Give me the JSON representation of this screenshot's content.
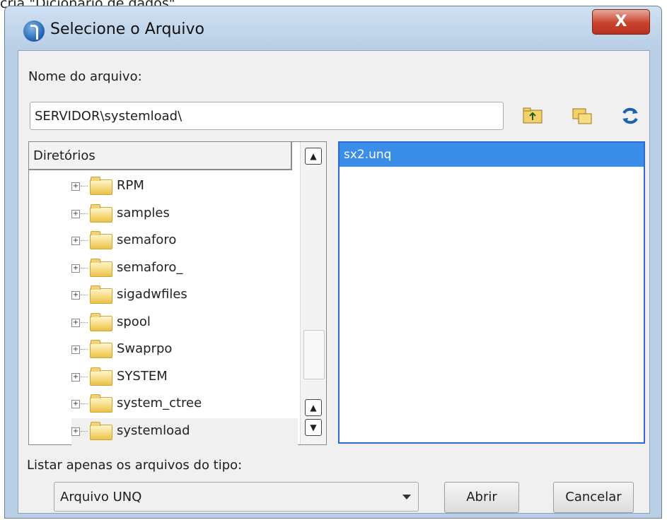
{
  "above_caption": "cria \"Dicionário de dados\"",
  "window": {
    "title": "Selecione o Arquivo",
    "close_label": "X"
  },
  "filename": {
    "label": "Nome do arquivo:",
    "value": "SERVIDOR\\systemload\\"
  },
  "toolbar": {
    "icons": [
      "folder-up-icon",
      "copy-folder-icon",
      "refresh-icon"
    ]
  },
  "directories": {
    "header": "Diretórios",
    "items": [
      {
        "name": "RPM"
      },
      {
        "name": "samples"
      },
      {
        "name": "semaforo"
      },
      {
        "name": "semaforo_"
      },
      {
        "name": "sigadwfiles"
      },
      {
        "name": "spool"
      },
      {
        "name": "Swaprpo"
      },
      {
        "name": "SYSTEM"
      },
      {
        "name": "system_ctree"
      },
      {
        "name": "systemload"
      }
    ],
    "selected": "systemload"
  },
  "files": {
    "items": [
      "sx2.unq"
    ],
    "selected": "sx2.unq"
  },
  "filter": {
    "label": "Listar apenas os arquivos do tipo:",
    "selected": "Arquivo UNQ"
  },
  "buttons": {
    "open": "Abrir",
    "cancel": "Cancelar"
  },
  "colors": {
    "selection": "#3a8ee8",
    "frame": "#b9cfe6",
    "close": "#c9422e"
  }
}
